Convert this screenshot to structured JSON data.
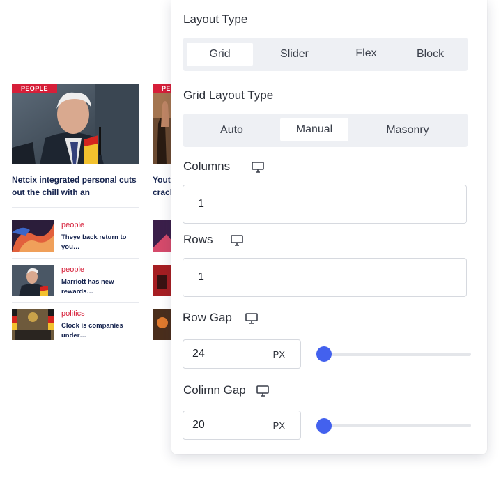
{
  "news": {
    "featured": [
      {
        "badge": "PEOPLE",
        "title": "Netcix integrated personal cuts out the chill with an"
      },
      {
        "badge": "PE",
        "title": "Youth crack"
      }
    ],
    "list_left": [
      {
        "category": "people",
        "title": "Theye back return to you…"
      },
      {
        "category": "people",
        "title": "Marriott has new rewards…"
      },
      {
        "category": "politics",
        "title": "Clock is companies under…"
      }
    ]
  },
  "panel": {
    "layout_type": {
      "label": "Layout Type",
      "options": [
        "Grid",
        "Slider",
        "Flex",
        "Block"
      ],
      "selected": "Grid"
    },
    "grid_layout_type": {
      "label": "Grid Layout Type",
      "options": [
        "Auto",
        "Manual",
        "Masonry"
      ],
      "selected": "Manual"
    },
    "columns": {
      "label": "Columns",
      "value": "1",
      "icon": "desktop-icon"
    },
    "rows": {
      "label": "Rows",
      "value": "1",
      "icon": "desktop-icon"
    },
    "row_gap": {
      "label": "Row Gap",
      "value": "24",
      "unit": "PX",
      "slider_fraction": 0.0
    },
    "column_gap": {
      "label": "Colimn  Gap",
      "value": "20",
      "unit": "PX",
      "slider_fraction": 0.0
    },
    "colors": {
      "accent": "#4361ee",
      "badge": "#d61f39",
      "title": "#14224d"
    }
  }
}
